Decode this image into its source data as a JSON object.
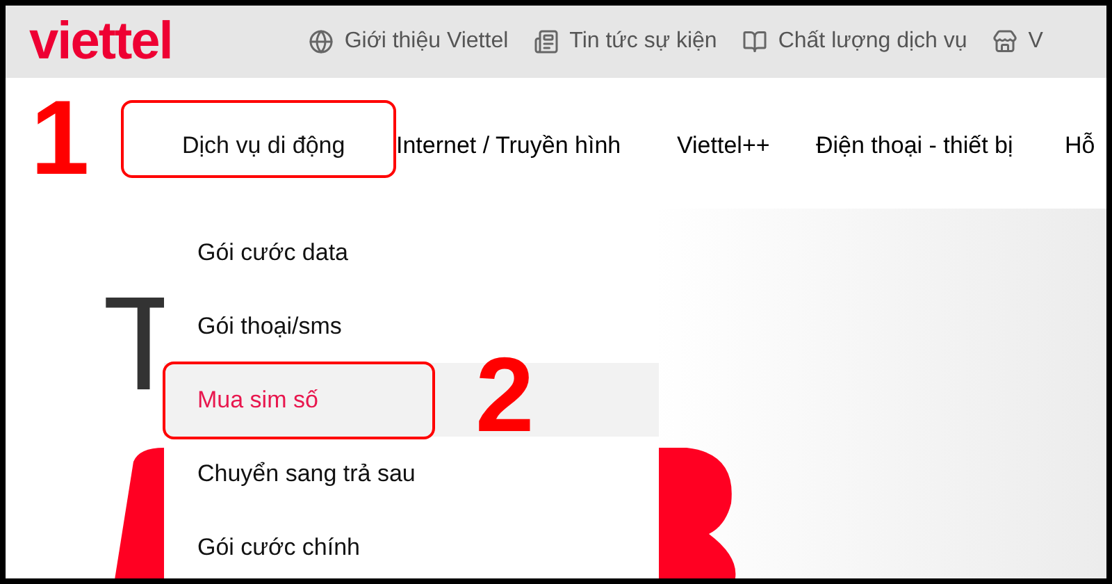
{
  "header": {
    "logo": "viettel",
    "links": [
      {
        "kind": "globe",
        "label": "Giới thiệu Viettel"
      },
      {
        "kind": "news",
        "label": "Tin tức sự kiện"
      },
      {
        "kind": "book",
        "label": "Chất lượng dịch vụ"
      },
      {
        "kind": "store",
        "label": "V"
      }
    ]
  },
  "nav": {
    "items": [
      {
        "label": "Dịch vụ di động",
        "selected": true
      },
      {
        "label": "Internet / Truyền hình",
        "selected": false
      },
      {
        "label": "Viettel++",
        "selected": false
      },
      {
        "label": "Điện thoại - thiết bị",
        "selected": false
      },
      {
        "label": "Hỗ",
        "selected": false
      }
    ]
  },
  "dropdown": {
    "items": [
      {
        "label": "Gói cước data",
        "selected": false
      },
      {
        "label": "Gói thoại/sms",
        "selected": false
      },
      {
        "label": "Mua sim số",
        "selected": true
      },
      {
        "label": "Chuyển sang trả sau",
        "selected": false
      },
      {
        "label": "Gói cước chính",
        "selected": false
      }
    ]
  },
  "hero": {
    "letter": "T"
  },
  "annotations": [
    {
      "label": "1"
    },
    {
      "label": "2"
    }
  ]
}
